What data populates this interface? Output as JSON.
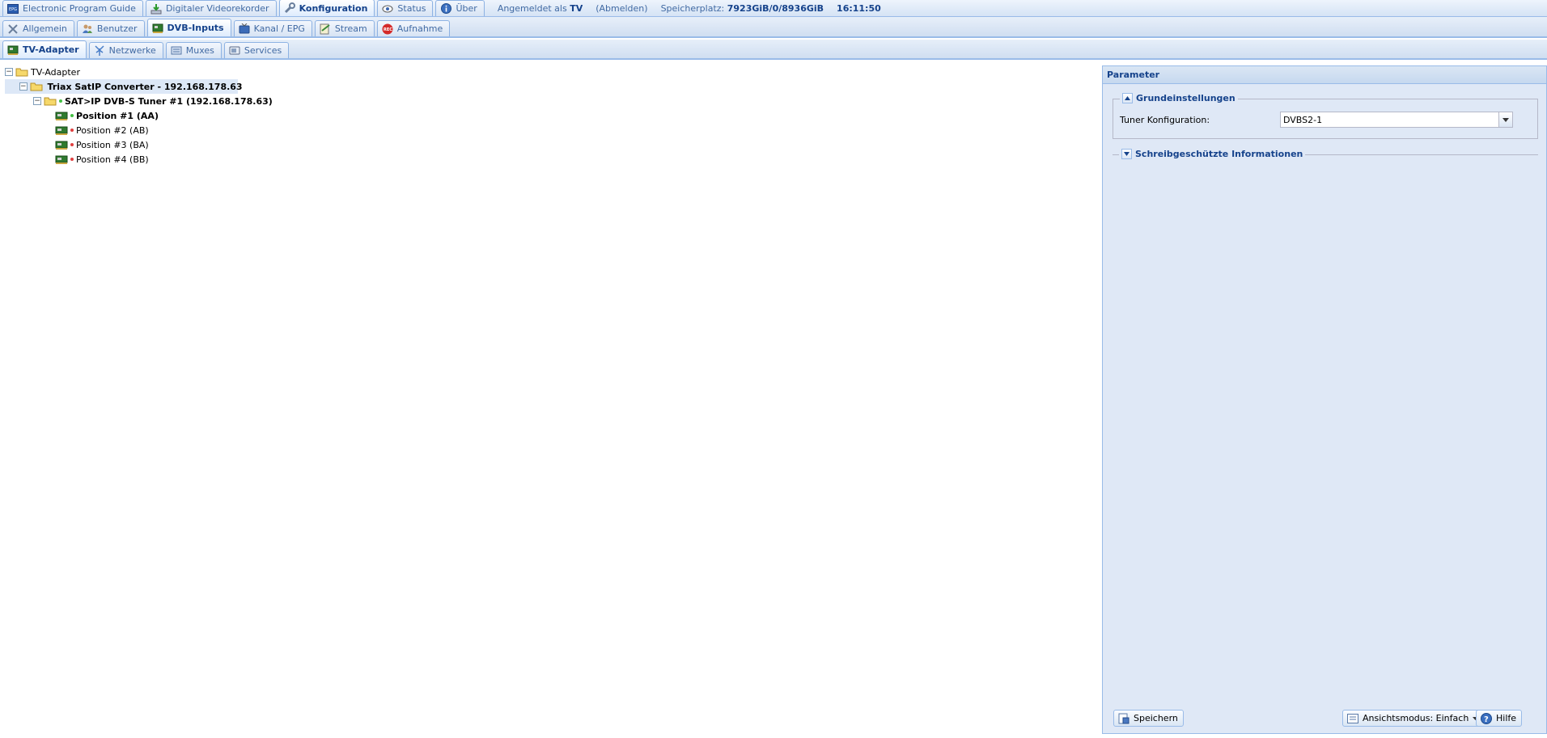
{
  "top_tabs": [
    {
      "label": "Electronic Program Guide",
      "icon": "epg-icon",
      "active": false
    },
    {
      "label": "Digitaler Videorekorder",
      "icon": "download-icon",
      "active": false
    },
    {
      "label": "Konfiguration",
      "icon": "wrench-icon",
      "active": true
    },
    {
      "label": "Status",
      "icon": "eye-icon",
      "active": false
    },
    {
      "label": "Über",
      "icon": "info-icon",
      "active": false
    }
  ],
  "login": {
    "prefix": "Angemeldet als",
    "user": "TV",
    "logout": "(Abmelden)"
  },
  "storage": {
    "label": "Speicherplatz:",
    "value": "7923GiB/0/8936GiB"
  },
  "clock": "16:11:50",
  "config_tabs": [
    {
      "label": "Allgemein",
      "icon": "tools-icon",
      "active": false
    },
    {
      "label": "Benutzer",
      "icon": "users-icon",
      "active": false
    },
    {
      "label": "DVB-Inputs",
      "icon": "tv-card-icon",
      "active": true
    },
    {
      "label": "Kanal / EPG",
      "icon": "tv-icon",
      "active": false
    },
    {
      "label": "Stream",
      "icon": "stream-icon",
      "active": false
    },
    {
      "label": "Aufnahme",
      "icon": "rec-icon",
      "active": false
    }
  ],
  "dvb_tabs": [
    {
      "label": "TV-Adapter",
      "icon": "tv-card-icon",
      "active": true
    },
    {
      "label": "Netzwerke",
      "icon": "antenna-icon",
      "active": false
    },
    {
      "label": "Muxes",
      "icon": "mux-icon",
      "active": false
    },
    {
      "label": "Services",
      "icon": "services-icon",
      "active": false
    }
  ],
  "tree": [
    {
      "label": "TV-Adapter",
      "level": 0,
      "type": "folder",
      "bold": false
    },
    {
      "label": "Triax SatIP Converter - 192.168.178.63",
      "level": 1,
      "type": "folder",
      "bold": true,
      "dot": "#44c044",
      "selected": true
    },
    {
      "label": "SAT>IP DVB-S Tuner #1 (192.168.178.63)",
      "level": 2,
      "type": "folder",
      "bold": true,
      "dot": "#44c044"
    },
    {
      "label": "Position #1 (AA)",
      "level": 3,
      "type": "card",
      "bold": true,
      "dot": "#44c044"
    },
    {
      "label": "Position #2 (AB)",
      "level": 3,
      "type": "card",
      "bold": false,
      "dot": "#e04040"
    },
    {
      "label": "Position #3 (BA)",
      "level": 3,
      "type": "card",
      "bold": false,
      "dot": "#e04040"
    },
    {
      "label": "Position #4 (BB)",
      "level": 3,
      "type": "card",
      "bold": false,
      "dot": "#e04040"
    }
  ],
  "panel": {
    "title": "Parameter",
    "basic": {
      "title": "Grundeinstellungen",
      "field_label": "Tuner Konfiguration:",
      "field_value": "DVBS2-1"
    },
    "readonly": {
      "title": "Schreibgeschützte Informationen"
    },
    "save": "Speichern",
    "view_mode": "Ansichtsmodus: Einfach",
    "help": "Hilfe"
  }
}
